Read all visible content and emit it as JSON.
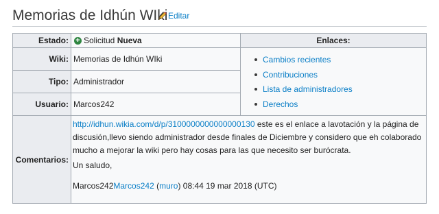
{
  "page": {
    "title": "Memorias de Idhún WIki",
    "edit_label": "Editar"
  },
  "table": {
    "estado_label": "Estado:",
    "estado_prefix": "Solicitud ",
    "estado_value": "Nueva",
    "enlaces_label": "Enlaces:",
    "wiki_label": "Wiki:",
    "wiki_value": "Memorias de Idhún WIki",
    "tipo_label": "Tipo:",
    "tipo_value": "Administrador",
    "usuario_label": "Usuario:",
    "usuario_value": "Marcos242",
    "comentarios_label": "Comentarios:"
  },
  "links": [
    {
      "label": "Cambios recientes"
    },
    {
      "label": "Contribuciones"
    },
    {
      "label": "Lista de administradores"
    },
    {
      "label": "Derechos"
    }
  ],
  "comment": {
    "url": "http://idhun.wikia.com/d/p/3100000000000000130",
    "text1": " este es el enlace a lavotación y la página de discusión,llevo siendo administrador desde finales de Diciembre y considero que eh colaborado mucho a mejorar la wiki pero hay cosas para las que necesito ser burócrata.",
    "text2": "Un saludo,",
    "sig_plain": "Marcos242",
    "sig_link": "Marcos242",
    "sig_open": " (",
    "sig_talk": "muro",
    "sig_close": ") 08:44 19 mar 2018 (UTC)"
  },
  "colors": {
    "link": "#0b7fc7",
    "header_bg": "#eaecf0",
    "cell_bg": "#f8f9fa",
    "border": "#a2a9b1",
    "status_icon": "#2e8540"
  },
  "icons": {
    "edit": "pencil-icon",
    "status": "plus-circle-icon"
  }
}
